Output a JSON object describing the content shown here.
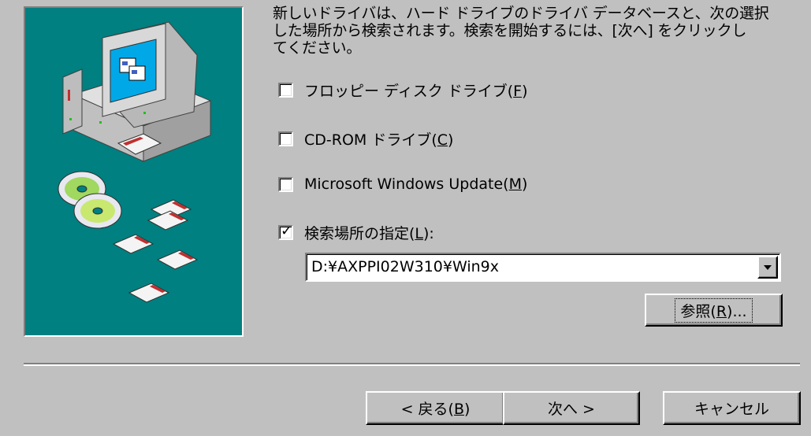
{
  "description": {
    "lines": [
      "新しいドライバは、ハード ドライブのドライバ データベースと、次の選択",
      "した場所から検索されます。検索を開始するには、[次へ] をクリックし",
      "てください。"
    ]
  },
  "options": [
    {
      "label": "フロッピー ディスク ドライブ(",
      "accel": "F",
      "suffix": ")",
      "checked": false
    },
    {
      "label": "CD-ROM ドライブ(",
      "accel": "C",
      "suffix": ")",
      "checked": false
    },
    {
      "label": "Microsoft Windows Update(",
      "accel": "M",
      "suffix": ")",
      "checked": false
    },
    {
      "label": "検索場所の指定(",
      "accel": "L",
      "suffix": "):",
      "checked": true
    }
  ],
  "location": {
    "value": "D:¥AXPPI02W310¥Win9x"
  },
  "browse_button": {
    "label": "参照(",
    "accel": "R",
    "suffix": ")..."
  },
  "footer": {
    "back": {
      "label": "< 戻る(",
      "accel": "B",
      "suffix": ")"
    },
    "next": {
      "label": "次へ >"
    },
    "cancel": {
      "label": "キャンセル"
    }
  },
  "colors": {
    "dialog_face": "#c0c0c0",
    "art_background": "#008080",
    "monitor_screen": "#00a8e8"
  },
  "icons": {
    "art": "computer-with-cds-and-floppies-illustration",
    "dropdown": "chevron-down-icon",
    "check": "check-icon"
  }
}
